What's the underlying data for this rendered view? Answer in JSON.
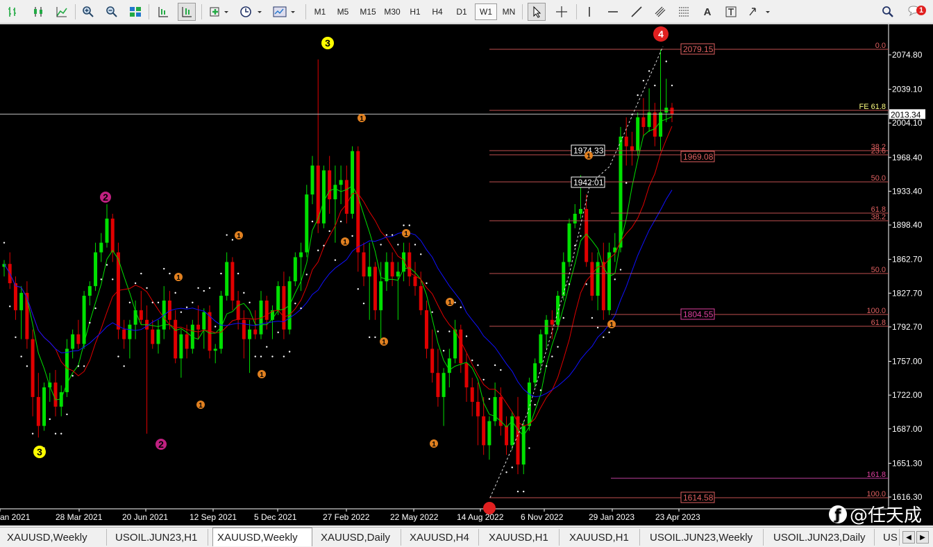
{
  "toolbar": {
    "timeframes": [
      "M1",
      "M5",
      "M15",
      "M30",
      "H1",
      "H4",
      "D1",
      "W1",
      "MN"
    ],
    "active_timeframe": "W1",
    "text_tool": "A",
    "notification_count": "1"
  },
  "chart": {
    "symbol": "XAUUSD",
    "period": "Weekly",
    "current_price": "2013.34",
    "price_axis": [
      "2074.80",
      "2039.10",
      "2004.10",
      "1968.40",
      "1933.40",
      "1898.40",
      "1862.70",
      "1827.70",
      "1792.70",
      "1757.00",
      "1722.00",
      "1687.00",
      "1651.30",
      "1616.30"
    ],
    "date_axis": [
      "an 2021",
      "28 Mar 2021",
      "20 Jun 2021",
      "12 Sep 2021",
      "5 Dec 2021",
      "27 Feb 2022",
      "22 May 2022",
      "14 Aug 2022",
      "6 Nov 2022",
      "29 Jan 2023",
      "23 Apr 2023"
    ],
    "fib_levels": [
      "0.0",
      "FE 61.8",
      "38.2",
      "23.6",
      "50.0",
      "61.8",
      "38.2",
      "50.0",
      "100.0",
      "61.8",
      "161.8",
      "100.0"
    ],
    "price_labels": [
      "2079.15",
      "1974.33",
      "1969.08",
      "1942.01",
      "1804.55",
      "1614.58"
    ],
    "wave_labels": [
      "3",
      "4",
      "3",
      "2",
      "2",
      "1",
      "1",
      "1",
      "1",
      "1",
      "1",
      "1",
      "1",
      "1",
      "1",
      "1",
      "1"
    ],
    "colors": {
      "background": "#000000",
      "bull": "#00e000",
      "bear": "#e00000",
      "ma_green": "#00e000",
      "ma_red": "#e00000",
      "ma_blue": "#1010ff",
      "fib_line": "#c05050",
      "wave_major": "#ffff00",
      "wave_minor": "#e08020"
    }
  },
  "tabs": [
    "XAUUSD,Weekly",
    "USOIL.JUN23,H1",
    "XAUUSD,Weekly",
    "XAUUSD,Daily",
    "XAUUSD,H4",
    "XAUUSD,H1",
    "XAUUSD,H1",
    "USOIL.JUN23,Weekly",
    "USOIL.JUN23,Daily",
    "US"
  ],
  "active_tab": 2,
  "watermark": "@任天成"
}
